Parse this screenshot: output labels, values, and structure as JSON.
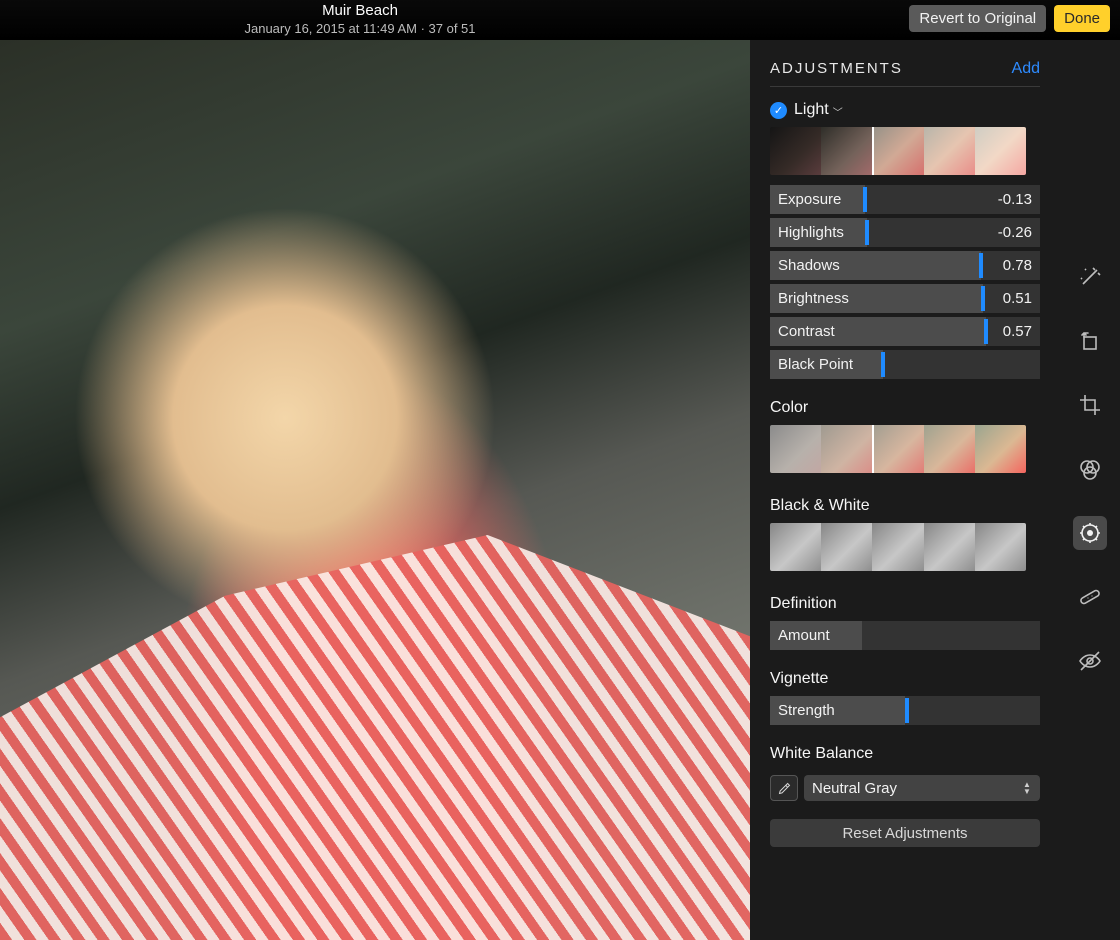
{
  "header": {
    "title": "Muir Beach",
    "meta": "January 16, 2015 at 11:49 AM  ·  37 of 51",
    "revert_label": "Revert to Original",
    "done_label": "Done"
  },
  "panel": {
    "heading": "ADJUSTMENTS",
    "add_label": "Add",
    "light_label": "Light",
    "sliders": [
      {
        "label": "Exposure",
        "value": "-0.13",
        "track": 35,
        "handle": 35
      },
      {
        "label": "Highlights",
        "value": "-0.26",
        "track": 36,
        "handle": 36
      },
      {
        "label": "Shadows",
        "value": "0.78",
        "track": 78,
        "handle": 78
      },
      {
        "label": "Brightness",
        "value": "0.51",
        "track": 79,
        "handle": 79
      },
      {
        "label": "Contrast",
        "value": "0.57",
        "track": 80,
        "handle": 80
      },
      {
        "label": "Black Point",
        "value": "",
        "track": 42,
        "handle": 42
      }
    ],
    "color_label": "Color",
    "bw_label": "Black & White",
    "definition_label": "Definition",
    "definition_param": "Amount",
    "vignette_label": "Vignette",
    "vignette_param": "Strength",
    "wb_label": "White Balance",
    "wb_value": "Neutral Gray",
    "reset_label": "Reset Adjustments"
  },
  "tools": {
    "wand": "auto-enhance-icon",
    "rotate": "rotate-icon",
    "crop": "crop-icon",
    "filters": "filters-icon",
    "adjust": "adjust-icon",
    "retouch": "retouch-icon",
    "redeye": "redeye-icon"
  },
  "colors": {
    "accent": "#1f8bff",
    "done": "#ffd02b"
  }
}
